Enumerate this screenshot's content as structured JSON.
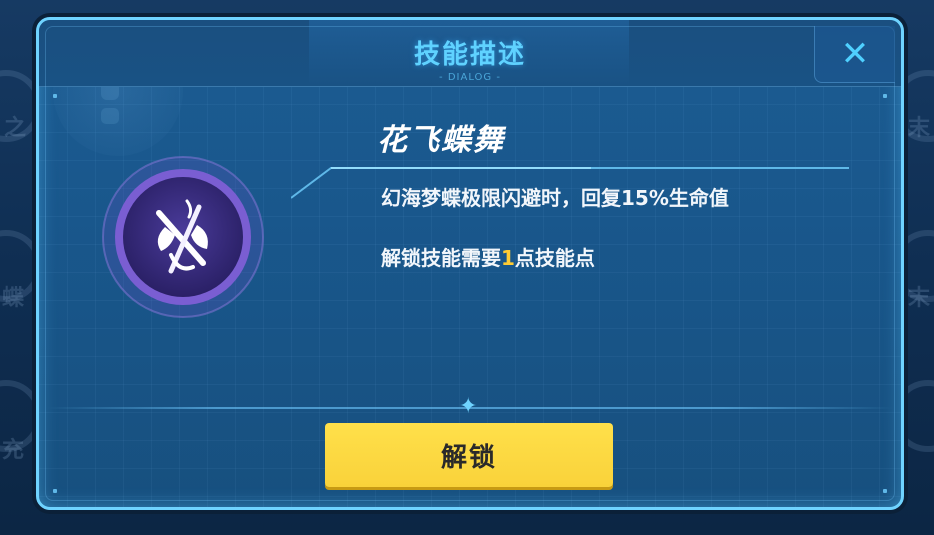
{
  "dialog": {
    "title": "技能描述",
    "subtitle": "- DIALOG -",
    "close_glyph": "✕",
    "close_icon": "close-icon"
  },
  "skill": {
    "name": "花飞蝶舞",
    "icon": "butterfly-dance-emblem-icon",
    "description": "幻海梦蝶极限闪避时，回复15%生命值",
    "unlock_prefix": "解锁技能需要",
    "unlock_points": "1",
    "unlock_suffix": "点技能点"
  },
  "actions": {
    "unlock_label": "解锁"
  },
  "background": {
    "left_labels": [
      "之",
      "蝶",
      "充"
    ],
    "right_labels": [
      "末",
      "末"
    ]
  },
  "colors": {
    "accent": "#5fd2ff",
    "button": "#ffe04a",
    "highlight_number": "#ffcc33",
    "panel": "#1c5c92"
  }
}
